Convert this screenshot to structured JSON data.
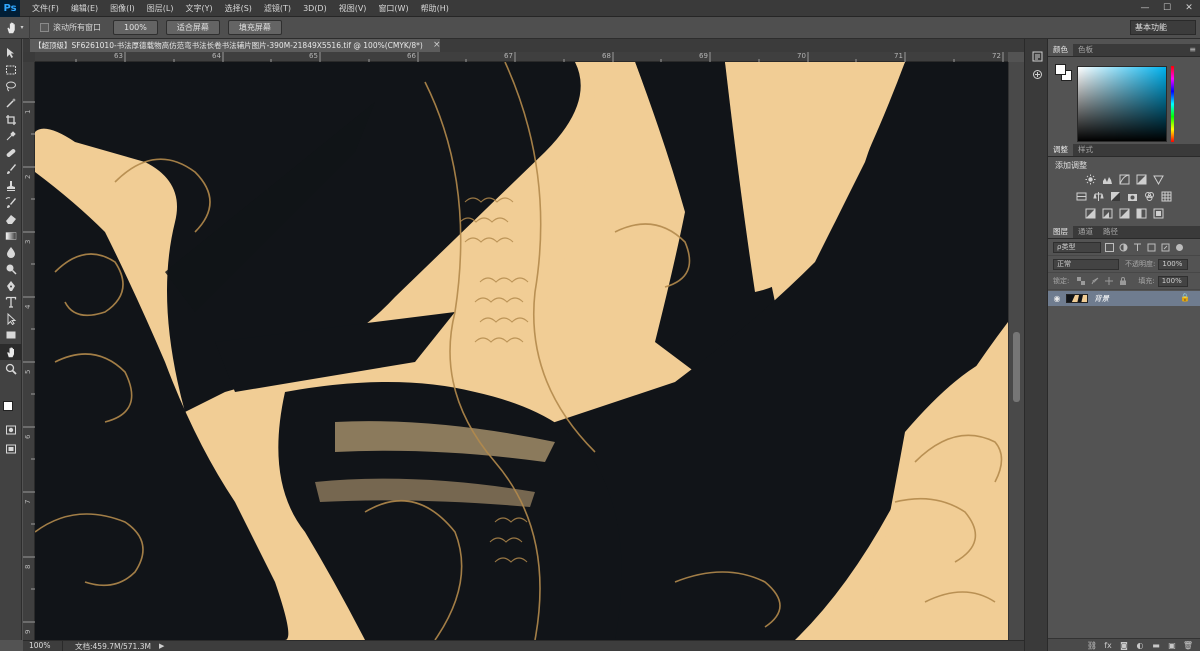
{
  "app": {
    "logo": "Ps",
    "menu": [
      "文件(F)",
      "编辑(E)",
      "图像(I)",
      "图层(L)",
      "文字(Y)",
      "选择(S)",
      "滤镜(T)",
      "3D(D)",
      "视图(V)",
      "窗口(W)",
      "帮助(H)"
    ],
    "window_controls": [
      "—",
      "☐",
      "✕"
    ]
  },
  "options_bar": {
    "tool_icon": "hand-icon",
    "scroll_all_windows_label": "滚动所有窗口",
    "buttons": [
      "100%",
      "适合屏幕",
      "填充屏幕"
    ],
    "workspace": "基本功能"
  },
  "document": {
    "tab_title": "【超顶级】SF6261010-书法厚德载物高仿范弯书法长卷书法辅片图片-390M-21849X5516.tif @ 100%(CMYK/8*)",
    "close": "×",
    "ruler_top_labels": [
      "63",
      "64",
      "65",
      "66",
      "67",
      "68",
      "69",
      "70",
      "71",
      "72"
    ],
    "ruler_left_labels": [
      "1",
      "2",
      "3",
      "4",
      "5",
      "6",
      "7",
      "8",
      "9"
    ],
    "canvas_colors": {
      "paper": "#f1cd95",
      "ink": "#111418",
      "gold": "#b38a4c"
    }
  },
  "status": {
    "zoom": "100%",
    "doc_info": "文档:459.7M/571.3M",
    "arrow": "▶"
  },
  "panels": {
    "color": {
      "tabs": [
        "颜色",
        "色板"
      ],
      "menu": "≡"
    },
    "adjustments": {
      "tabs": [
        "调整",
        "样式"
      ],
      "title": "添加调整"
    },
    "layers": {
      "tabs": [
        "图层",
        "通道",
        "路径"
      ],
      "filter_kind": "ρ类型",
      "blend_mode": "正常",
      "opacity_label": "不透明度:",
      "opacity_value": "100%",
      "lock_label": "锁定:",
      "fill_label": "填充:",
      "fill_value": "100%",
      "layer_name": "背景",
      "footer_icons": [
        "⛓",
        "fx",
        "◙",
        "◐",
        "▬",
        "▣",
        "🗑"
      ]
    }
  }
}
